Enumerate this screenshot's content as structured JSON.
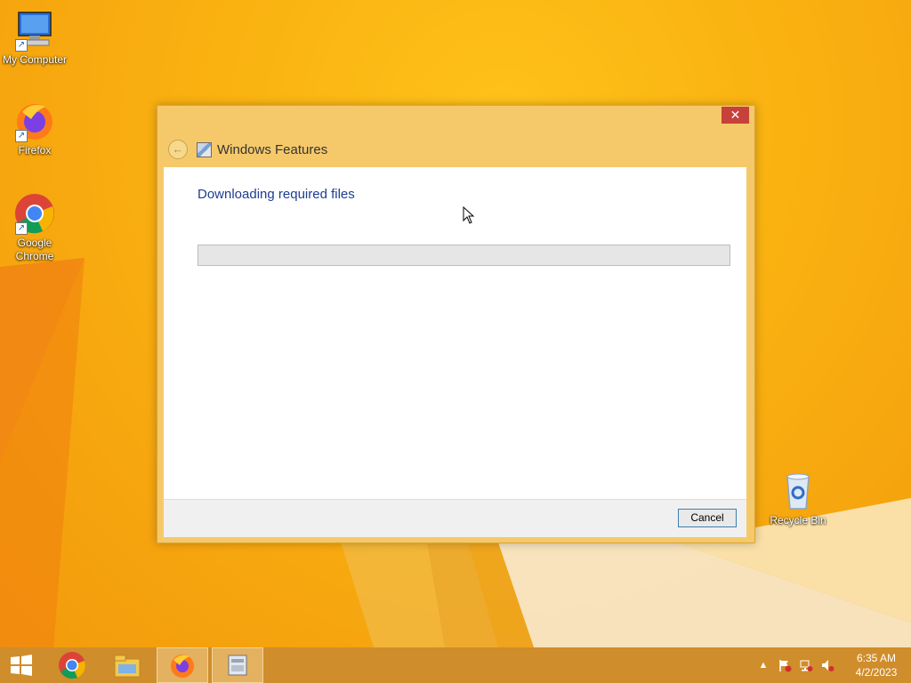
{
  "desktop": {
    "icons": [
      {
        "label": "My Computer"
      },
      {
        "label": "Firefox"
      },
      {
        "label": "Google Chrome"
      },
      {
        "label": "Recycle Bin"
      }
    ]
  },
  "dialog": {
    "title": "Windows Features",
    "close_glyph": "✕",
    "back_glyph": "←",
    "heading": "Downloading required files",
    "progress_fraction": 0.0,
    "cancel_label": "Cancel"
  },
  "taskbar": {
    "items": [
      "start-icon",
      "chrome-icon",
      "file-explorer-icon",
      "firefox-icon",
      "windows-features-icon"
    ],
    "tray": {
      "show_hidden_glyph": "▲",
      "time": "6:35 AM",
      "date": "4/2/2023"
    }
  },
  "colors": {
    "accent": "#f5c96a",
    "taskbar": "#cf8d2b",
    "heading": "#1e3d8f",
    "close": "#c7413b"
  }
}
